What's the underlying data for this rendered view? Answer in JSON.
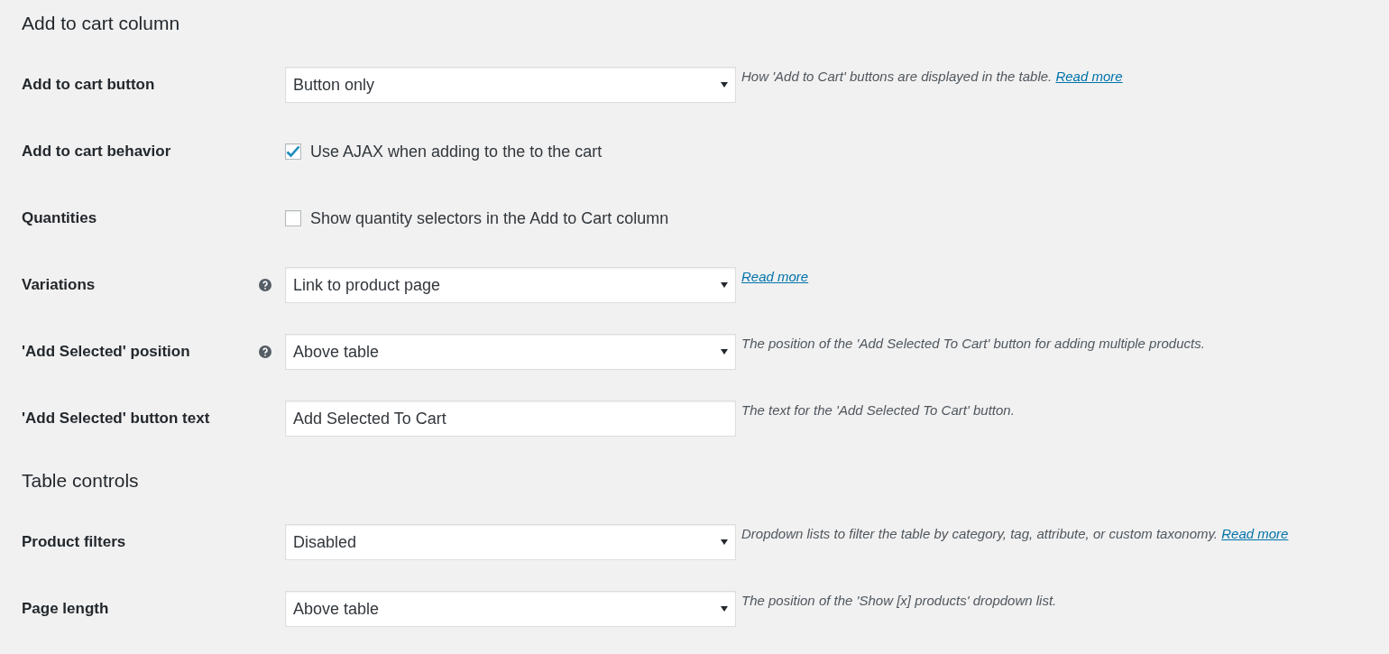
{
  "sections": [
    {
      "title": "Add to cart column",
      "rows": [
        {
          "label": "Add to cart button",
          "help": false,
          "kind": "select",
          "value": "Button only",
          "description": "How 'Add to Cart' buttons are displayed in the table.",
          "link": "Read more"
        },
        {
          "label": "Add to cart behavior",
          "help": false,
          "kind": "checkbox",
          "text": "Use AJAX when adding to the to the cart",
          "checked": true
        },
        {
          "label": "Quantities",
          "help": false,
          "kind": "checkbox",
          "text": "Show quantity selectors in the Add to Cart column",
          "checked": false
        },
        {
          "label": "Variations",
          "help": true,
          "kind": "select",
          "value": "Link to product page",
          "link": "Read more"
        },
        {
          "label": "'Add Selected' position",
          "help": true,
          "kind": "select",
          "value": "Above table",
          "description": "The position of the 'Add Selected To Cart' button for adding multiple products."
        },
        {
          "label": "'Add Selected' button text",
          "help": false,
          "kind": "text",
          "value": "Add Selected To Cart",
          "description": "The text for the 'Add Selected To Cart' button."
        }
      ]
    },
    {
      "title": "Table controls",
      "rows": [
        {
          "label": "Product filters",
          "help": false,
          "kind": "select",
          "value": "Disabled",
          "description": "Dropdown lists to filter the table by category, tag, attribute, or custom taxonomy.",
          "link": "Read more"
        },
        {
          "label": "Page length",
          "help": false,
          "kind": "select",
          "value": "Above table",
          "description": "The position of the 'Show [x] products' dropdown list."
        }
      ]
    }
  ]
}
